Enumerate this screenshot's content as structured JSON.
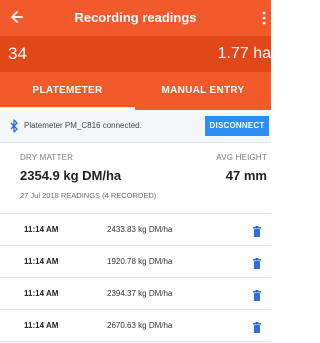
{
  "header": {
    "title": "Recording readings",
    "back_icon": "arrow-left-icon",
    "more_icon": "more-vertical-icon"
  },
  "stats": {
    "left_value": "34",
    "right_value": "1.77 ha"
  },
  "tabs": [
    {
      "label": "PLATEMETER",
      "active": true
    },
    {
      "label": "MANUAL ENTRY",
      "active": false
    }
  ],
  "connection": {
    "message": "Platemeter PM_C816 connected.",
    "disconnect_label": "DISCONNECT",
    "icon": "bluetooth-icon"
  },
  "summary": {
    "dry_matter_label": "DRY MATTER",
    "avg_height_label": "AVG HEIGHT",
    "dry_matter_value": "2354.9 kg DM/ha",
    "avg_height_value": "47 mm",
    "readings_meta": "27 Jul 2018 READINGS  (4 RECORDED)"
  },
  "readings": [
    {
      "time": "11:14 AM",
      "value": "2433.83 kg DM/ha"
    },
    {
      "time": "11:14 AM",
      "value": "1920.78 kg DM/ha"
    },
    {
      "time": "11:14 AM",
      "value": "2394.37 kg DM/ha"
    },
    {
      "time": "11:14 AM",
      "value": "2670.63 kg DM/ha"
    }
  ],
  "colors": {
    "primary": "#f35a2b",
    "primary_dark": "#e2471a",
    "accent_button": "#2d8ef2",
    "delete_icon": "#2d6fd6"
  }
}
